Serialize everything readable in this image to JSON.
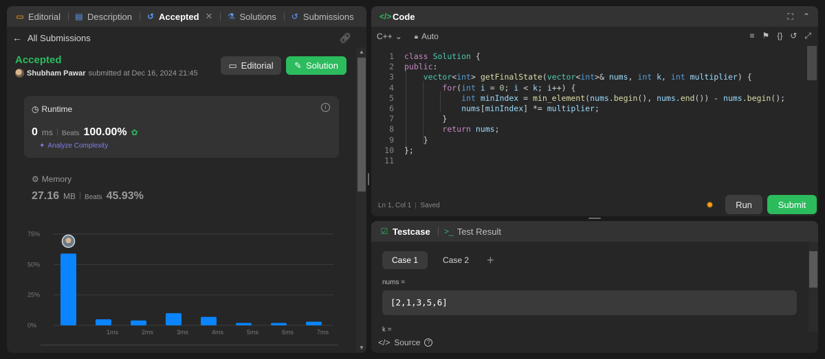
{
  "left_tabs": [
    {
      "label": "Editorial",
      "icon": "book-icon",
      "active": false
    },
    {
      "label": "Description",
      "icon": "document-icon",
      "active": false
    },
    {
      "label": "Accepted",
      "icon": "history-icon",
      "active": true
    },
    {
      "label": "Solutions",
      "icon": "flask-icon",
      "active": false
    },
    {
      "label": "Submissions",
      "icon": "history-icon",
      "active": false
    }
  ],
  "submission": {
    "back_label": "All Submissions",
    "status": "Accepted",
    "user": "Shubham Pawar",
    "submitted_text": "submitted at Dec 16, 2024 21:45",
    "editorial_button": "Editorial",
    "solution_button": "Solution"
  },
  "runtime": {
    "title": "Runtime",
    "value": "0",
    "unit": "ms",
    "beats_label": "Beats",
    "beats": "100.00%",
    "analyze": "Analyze Complexity"
  },
  "memory": {
    "title": "Memory",
    "value": "27.16",
    "unit": "MB",
    "beats_label": "Beats",
    "beats": "45.93%"
  },
  "chart_data": {
    "type": "bar",
    "categories": [
      "",
      "1ms",
      "2ms",
      "3ms",
      "4ms",
      "5ms",
      "6ms",
      "7ms"
    ],
    "values": [
      59,
      5,
      4,
      10,
      7,
      2,
      2,
      3
    ],
    "yticks": [
      "0%",
      "25%",
      "50%",
      "75%"
    ],
    "ylim": [
      0,
      75
    ],
    "highlight_index": 0,
    "bar_color": "#0a84ff"
  },
  "code": {
    "title": "Code",
    "language": "C++",
    "mode": "Auto",
    "lines": [
      "class Solution {",
      "public:",
      "    vector<int> getFinalState(vector<int>& nums, int k, int multiplier) {",
      "        for(int i = 0; i < k; i++) {",
      "            int minIndex = min_element(nums.begin(), nums.end()) - nums.begin();",
      "            nums[minIndex] *= multiplier;",
      "        }",
      "        return nums;",
      "    }",
      "};",
      ""
    ],
    "cursor_position": "Ln 1, Col 1",
    "saved": "Saved",
    "run_label": "Run",
    "submit_label": "Submit"
  },
  "testcase": {
    "tab_label": "Testcase",
    "result_tab_label": "Test Result",
    "cases": [
      "Case 1",
      "Case 2"
    ],
    "nums_label": "nums =",
    "nums_value": "[2,1,3,5,6]",
    "k_label": "k =",
    "source_label": "Source"
  }
}
